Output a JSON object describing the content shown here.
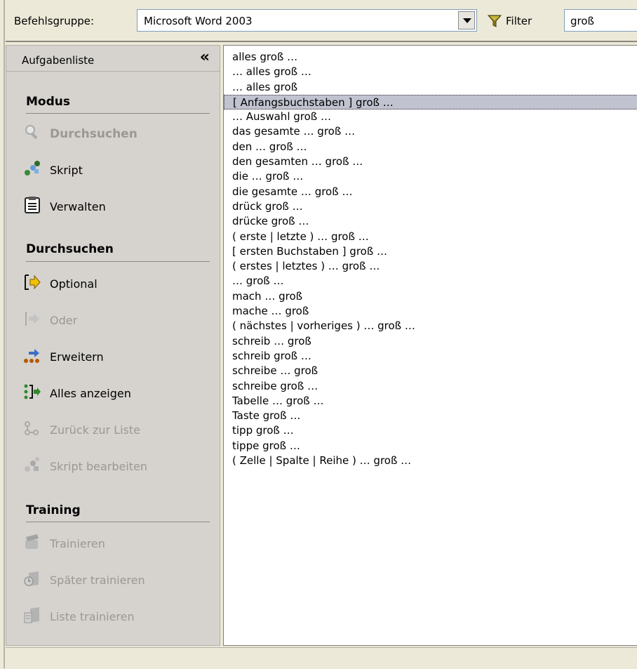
{
  "toolbar": {
    "group_label": "Befehlsgruppe:",
    "group_value": "Microsoft Word 2003",
    "filter_label": "Filter",
    "filter_value": "groß"
  },
  "sidebar": {
    "title": "Aufgabenliste",
    "collapse_glyph": "«",
    "modus": {
      "title": "Modus",
      "items": [
        {
          "label": "Durchsuchen",
          "icon": "magnifier-icon",
          "disabled": true
        },
        {
          "label": "Skript",
          "icon": "script-icon",
          "disabled": false
        },
        {
          "label": "Verwalten",
          "icon": "clipboard-icon",
          "disabled": false
        }
      ]
    },
    "durchsuchen": {
      "title": "Durchsuchen",
      "items": [
        {
          "label": "Optional",
          "icon": "optional-icon",
          "disabled": false
        },
        {
          "label": "Oder",
          "icon": "or-arrow-icon",
          "disabled": true
        },
        {
          "label": "Erweitern",
          "icon": "expand-icon",
          "disabled": false
        },
        {
          "label": "Alles anzeigen",
          "icon": "show-all-icon",
          "disabled": false
        },
        {
          "label": "Zurück zur Liste",
          "icon": "back-to-list-icon",
          "disabled": true
        },
        {
          "label": "Skript bearbeiten",
          "icon": "edit-script-icon",
          "disabled": true
        }
      ]
    },
    "training": {
      "title": "Training",
      "items": [
        {
          "label": "Trainieren",
          "icon": "train-icon",
          "disabled": true
        },
        {
          "label": "Später trainieren",
          "icon": "train-later-icon",
          "disabled": true
        },
        {
          "label": "Liste trainieren",
          "icon": "train-list-icon",
          "disabled": true
        }
      ]
    }
  },
  "list": {
    "selected_index": 3,
    "items": [
      "alles groß …",
      "… alles groß …",
      "… alles groß",
      "[ Anfangsbuchstaben ] groß …",
      "… Auswahl groß …",
      "das gesamte … groß …",
      "den … groß …",
      "den gesamten … groß …",
      "die … groß …",
      "die gesamte … groß …",
      "drück groß …",
      "drücke groß …",
      "( erste | letzte ) … groß …",
      "[ ersten Buchstaben ] groß …",
      "( erstes | letztes ) … groß …",
      "… groß …",
      "mach … groß",
      "mache … groß",
      "( nächstes | vorheriges ) … groß …",
      "schreib … groß",
      "schreib groß …",
      "schreibe … groß",
      "schreibe groß …",
      "Tabelle … groß …",
      "Taste groß …",
      "tipp groß …",
      "tippe groß …",
      "( Zelle | Spalte | Reihe ) … groß …"
    ]
  },
  "colors": {
    "window_bg": "#ece9d8",
    "sidebar_bg": "#d6d3ce",
    "selection_bg": "#c1c3d0",
    "disabled_text": "#9a9893"
  }
}
